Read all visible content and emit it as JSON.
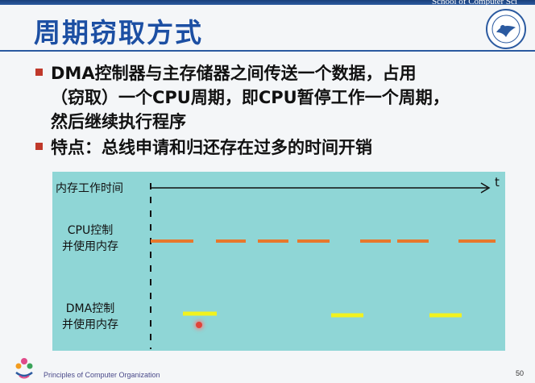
{
  "header": {
    "school": "School of Computer Sci",
    "title": "周期窃取方式"
  },
  "bullets": [
    {
      "lines": [
        "DMA控制器与主存储器之间传送一个数据，占用",
        "（窃取）一个CPU周期，即CPU暂停工作一个周期，",
        "然后继续执行程序"
      ]
    },
    {
      "lines": [
        "特点：总线申请和归还存在过多的时间开销"
      ]
    }
  ],
  "diagram": {
    "axis_label": "内存工作时间",
    "axis_symbol": "t",
    "cpu_label": [
      "CPU控制",
      "并使用内存"
    ],
    "dma_label": [
      "DMA控制",
      "并使用内存"
    ],
    "colors": {
      "background": "#8fd6d6",
      "cpu": "#e8782c",
      "dma": "#f2f21e"
    }
  },
  "footer": {
    "course": "Principles of Computer Organization",
    "page": "50"
  }
}
